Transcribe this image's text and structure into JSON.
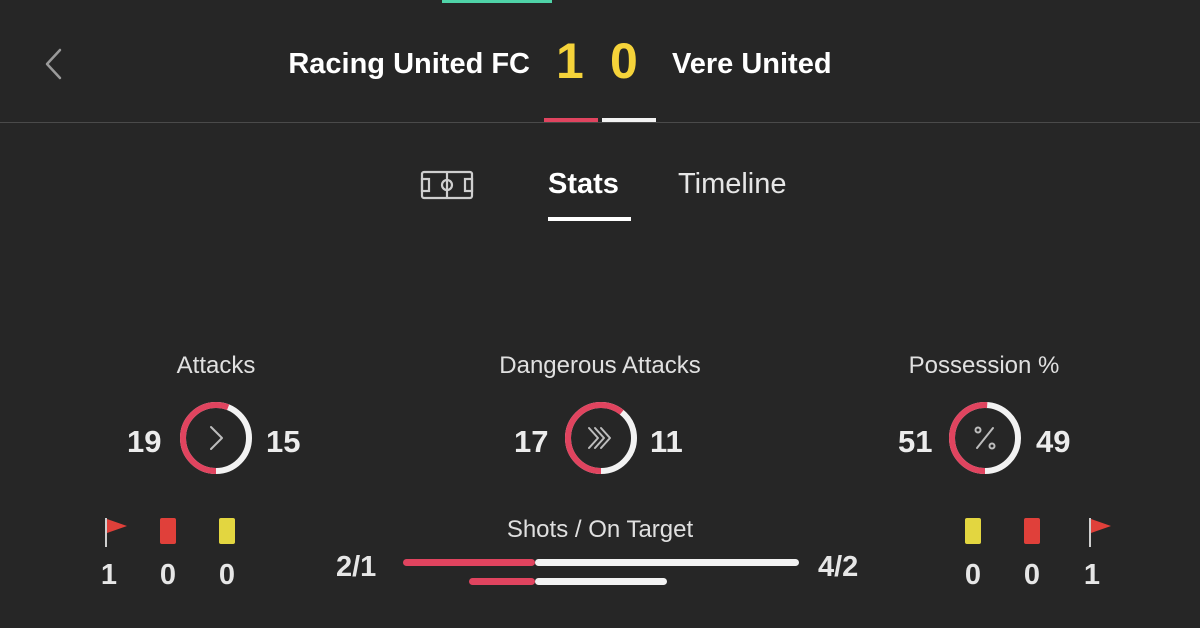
{
  "match": {
    "home_team": "Racing United FC",
    "away_team": "Vere United",
    "home_score": "1",
    "away_score": "0"
  },
  "tabs": [
    {
      "label": "Stats",
      "active": true
    },
    {
      "label": "Timeline",
      "active": false
    }
  ],
  "stats": {
    "attacks": {
      "title": "Attacks",
      "home": "19",
      "away": "15",
      "icon": "chevron-right-icon"
    },
    "dangerous_attacks": {
      "title": "Dangerous Attacks",
      "home": "17",
      "away": "11",
      "icon": "triple-chevron-icon"
    },
    "possession": {
      "title": "Possession %",
      "home": "51",
      "away": "49",
      "icon": "percent-icon"
    }
  },
  "discipline": {
    "home": {
      "corners": "1",
      "red_cards": "0",
      "yellow_cards": "0"
    },
    "away": {
      "yellow_cards": "0",
      "red_cards": "0",
      "corners": "1"
    }
  },
  "shots": {
    "title": "Shots / On Target",
    "home": "2/1",
    "away": "4/2",
    "home_shots": 2,
    "away_shots": 4,
    "home_on_target": 1,
    "away_on_target": 2
  },
  "colors": {
    "home": "#e0445f",
    "away": "#f2f2f2",
    "score": "#f5d33a",
    "yellow_card": "#e3d640",
    "red_card": "#e0403a",
    "corner_flag": "#e0403a"
  }
}
